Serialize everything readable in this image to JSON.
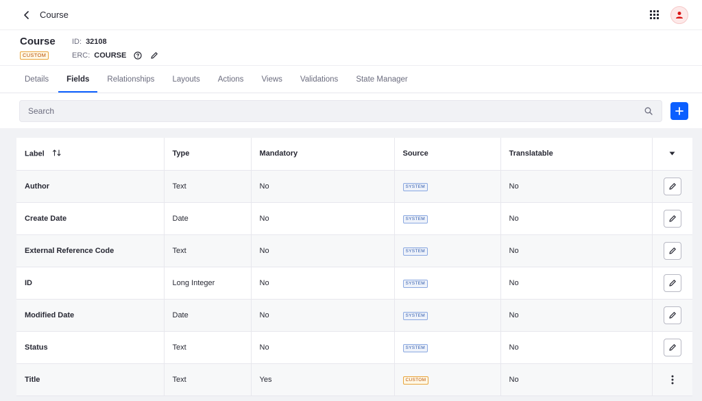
{
  "topbar": {
    "title": "Course",
    "back_icon": "chevron-left-icon",
    "apps_icon": "grid-icon",
    "avatar_icon": "user-icon"
  },
  "object": {
    "name": "Course",
    "badge": "CUSTOM",
    "id_label": "ID:",
    "id_value": "32108",
    "erc_label": "ERC:",
    "erc_value": "COURSE"
  },
  "tabs": [
    {
      "label": "Details",
      "active": false
    },
    {
      "label": "Fields",
      "active": true
    },
    {
      "label": "Relationships",
      "active": false
    },
    {
      "label": "Layouts",
      "active": false
    },
    {
      "label": "Actions",
      "active": false
    },
    {
      "label": "Views",
      "active": false
    },
    {
      "label": "Validations",
      "active": false
    },
    {
      "label": "State Manager",
      "active": false
    }
  ],
  "search": {
    "placeholder": "Search"
  },
  "table": {
    "columns": [
      "Label",
      "Type",
      "Mandatory",
      "Source",
      "Translatable"
    ],
    "rows": [
      {
        "label": "Author",
        "type": "Text",
        "mandatory": "No",
        "source": "SYSTEM",
        "translatable": "No",
        "action": "edit"
      },
      {
        "label": "Create Date",
        "type": "Date",
        "mandatory": "No",
        "source": "SYSTEM",
        "translatable": "No",
        "action": "edit"
      },
      {
        "label": "External Reference Code",
        "type": "Text",
        "mandatory": "No",
        "source": "SYSTEM",
        "translatable": "No",
        "action": "edit"
      },
      {
        "label": "ID",
        "type": "Long Integer",
        "mandatory": "No",
        "source": "SYSTEM",
        "translatable": "No",
        "action": "edit"
      },
      {
        "label": "Modified Date",
        "type": "Date",
        "mandatory": "No",
        "source": "SYSTEM",
        "translatable": "No",
        "action": "edit"
      },
      {
        "label": "Status",
        "type": "Text",
        "mandatory": "No",
        "source": "SYSTEM",
        "translatable": "No",
        "action": "edit"
      },
      {
        "label": "Title",
        "type": "Text",
        "mandatory": "Yes",
        "source": "CUSTOM",
        "translatable": "No",
        "action": "kebab"
      }
    ]
  },
  "colors": {
    "accent": "#0b5fff",
    "custom_badge": "#b95000",
    "system_badge": "#2e5aac"
  }
}
